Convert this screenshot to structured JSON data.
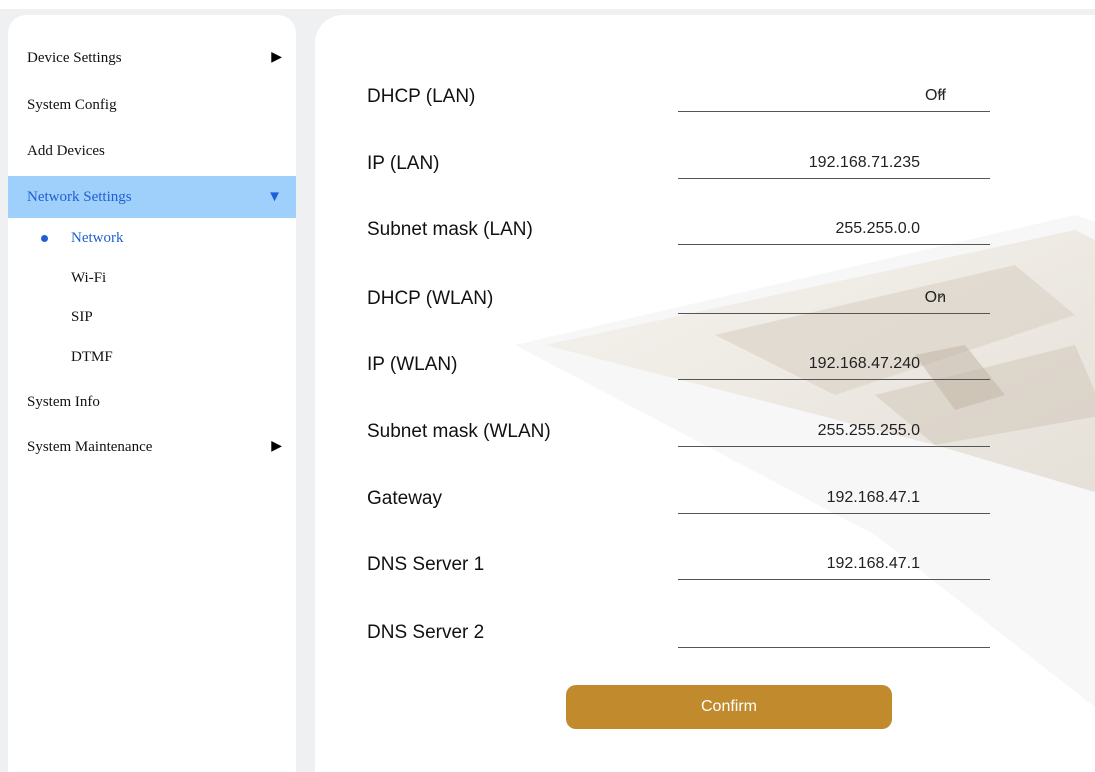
{
  "sidebar": {
    "device_settings": "Device Settings",
    "system_config": "System Config",
    "add_devices": "Add Devices",
    "network_settings": "Network Settings",
    "sub": [
      "Network",
      "Wi-Fi",
      "SIP",
      "DTMF"
    ],
    "system_info": "System Info",
    "system_maintenance": "System Maintenance",
    "arrow_right": "▶",
    "arrow_down": "▼"
  },
  "form": {
    "dhcp_lan": {
      "label": "DHCP (LAN)",
      "value": "Off"
    },
    "ip_lan": {
      "label": "IP (LAN)",
      "value": "192.168.71.235"
    },
    "subnet_lan": {
      "label": "Subnet mask (LAN)",
      "value": "255.255.0.0"
    },
    "dhcp_wlan": {
      "label": "DHCP (WLAN)",
      "value": "On"
    },
    "ip_wlan": {
      "label": "IP (WLAN)",
      "value": "192.168.47.240"
    },
    "subnet_wlan": {
      "label": "Subnet mask (WLAN)",
      "value": "255.255.255.0"
    },
    "gateway": {
      "label": "Gateway",
      "value": "192.168.47.1"
    },
    "dns1": {
      "label": "DNS Server 1",
      "value": "192.168.47.1"
    },
    "dns2": {
      "label": "DNS Server 2",
      "value": ""
    },
    "chevron": "⌄"
  },
  "confirm_label": "Confirm",
  "colors": {
    "accent": "#c08a2d",
    "active_bg": "#9fd0fb",
    "active_text": "#1f5fd6"
  }
}
